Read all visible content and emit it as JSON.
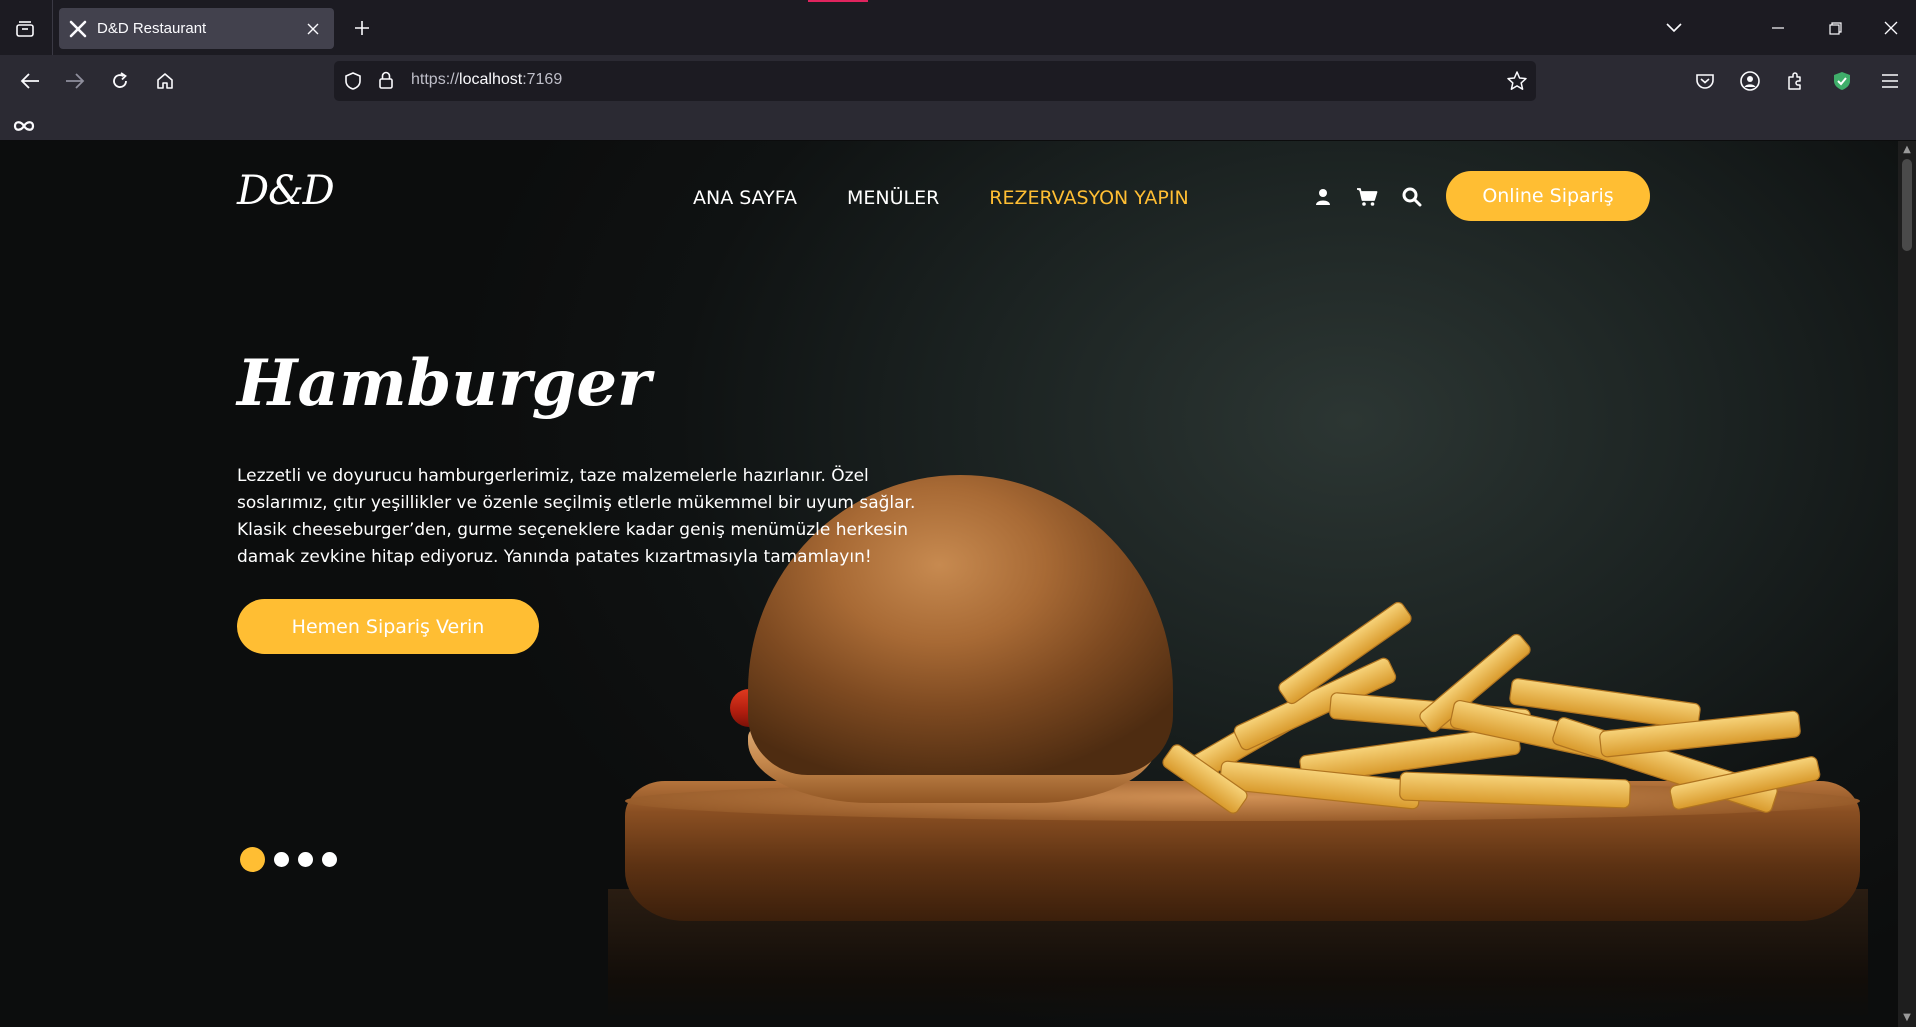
{
  "browser": {
    "tab": {
      "title": "D&D Restaurant",
      "favicon": "cutlery-icon"
    },
    "url": {
      "scheme": "https://",
      "host": "localhost",
      "port": ":7169"
    },
    "icons": [
      "tab-list-icon",
      "new-tab-icon",
      "list-all-tabs-icon",
      "minimize-icon",
      "restore-icon",
      "close-window-icon",
      "back-icon",
      "forward-icon",
      "reload-icon",
      "home-icon",
      "shield-icon",
      "lock-icon",
      "bookmark-star-icon",
      "pocket-icon",
      "account-icon",
      "extensions-icon",
      "vpn-shield-icon",
      "menu-icon",
      "infinity-bookmark-icon"
    ],
    "accent_color": "#e0245e"
  },
  "site": {
    "logo": "D&D",
    "nav": [
      {
        "label": "ANA SAYFA",
        "active": false
      },
      {
        "label": "MENÜLER",
        "active": false
      },
      {
        "label": "REZERVASYON YAPIN",
        "active": true
      }
    ],
    "header_icons": [
      "user-icon",
      "cart-icon",
      "search-icon"
    ],
    "order_button": "Online Sipariş",
    "accent_color": "#ffbe33"
  },
  "hero": {
    "title": "Hamburger",
    "description": "Lezzetli ve doyurucu hamburgerlerimiz, taze malzemelerle hazırlanır. Özel soslarımız, çıtır yeşillikler ve özenle seçilmiş etlerle mükemmel bir uyum sağlar. Klasik cheeseburger’den, gurme seçeneklere kadar geniş menümüzle herkesin damak zevkine hitap ediyoruz. Yanında patates kızartmasıyla tamamlayın!",
    "cta": "Hemen Sipariş Verin",
    "slides": {
      "total": 4,
      "active": 1
    }
  }
}
